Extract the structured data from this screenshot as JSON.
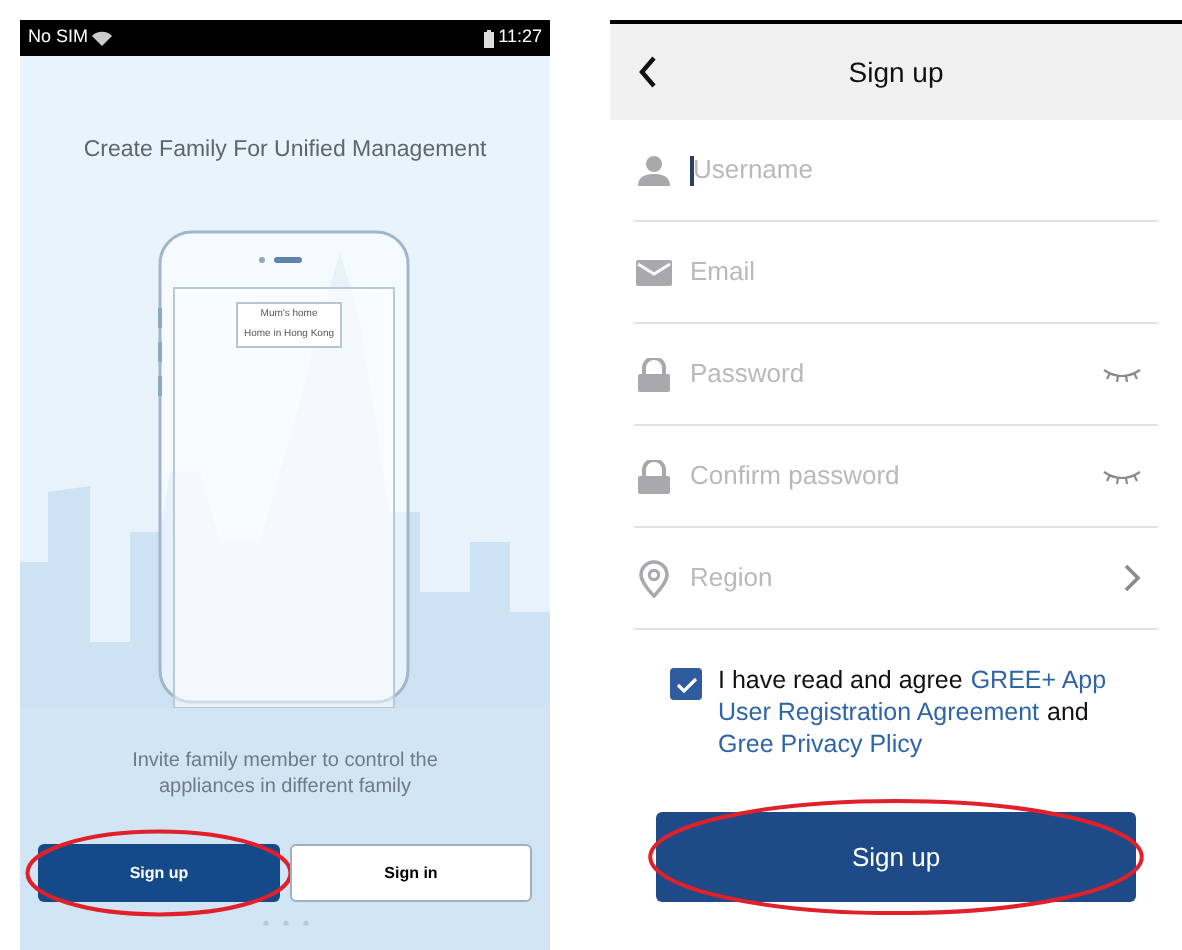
{
  "welcome_screen": {
    "status_bar": {
      "carrier": "No SIM",
      "time": "11:27"
    },
    "title": "Create Family For Unified Management",
    "illustration_cards": [
      "Mum's home",
      "Home in Hong Kong"
    ],
    "description": "Invite family member to control the appliances in different family",
    "buttons": [
      {
        "label": "Sign up",
        "kind": "primary"
      },
      {
        "label": "Sign in",
        "kind": "secondary"
      }
    ]
  },
  "signup_screen": {
    "header": {
      "title": "Sign up"
    },
    "fields": [
      {
        "kind": "user",
        "placeholder": "Username",
        "focused": true
      },
      {
        "kind": "email",
        "placeholder": "Email",
        "focused": false
      },
      {
        "kind": "password",
        "placeholder": "Password",
        "focused": false
      },
      {
        "kind": "password",
        "placeholder": "Confirm password",
        "focused": false
      },
      {
        "kind": "region",
        "placeholder": "Region",
        "focused": false
      }
    ],
    "agreement": {
      "checked": true,
      "parts": [
        {
          "kind": "text",
          "text": "I have read and agree"
        },
        {
          "kind": "link",
          "text": "GREE+ App"
        },
        {
          "kind": "link",
          "text": "User Registration Agreement"
        },
        {
          "kind": "text",
          "text": "and"
        },
        {
          "kind": "link",
          "text": "Gree Privacy Plicy"
        }
      ]
    },
    "submit": {
      "label": "Sign up"
    }
  }
}
